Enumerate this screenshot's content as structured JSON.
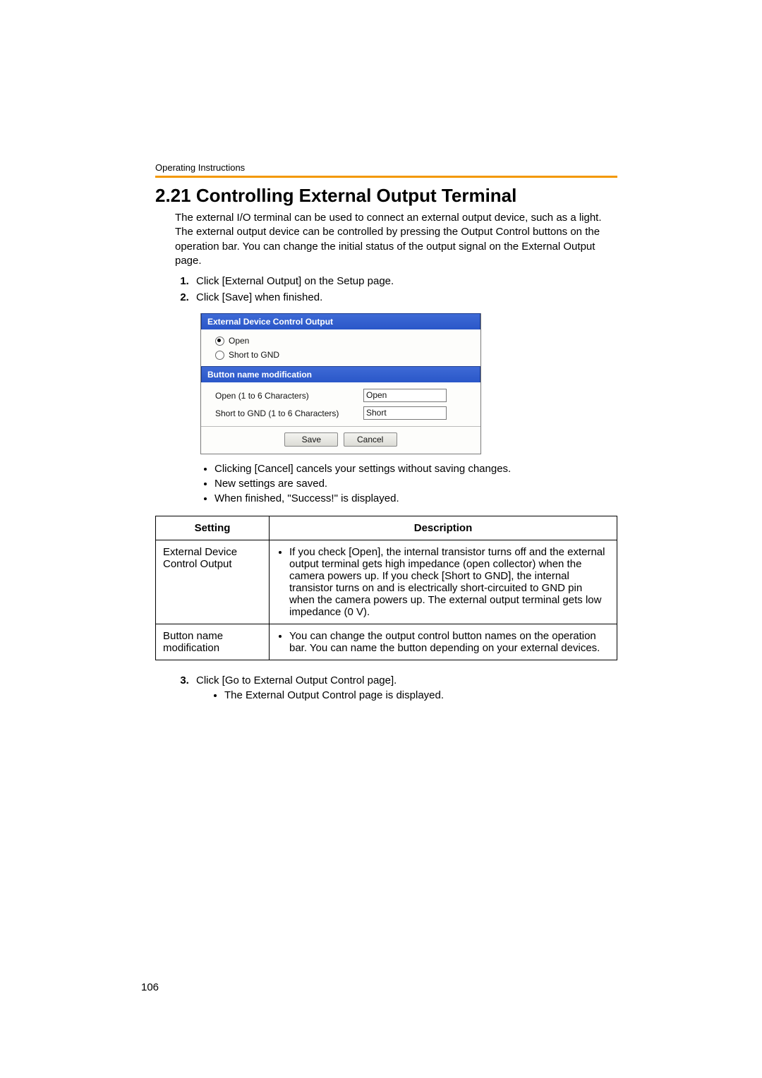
{
  "header": {
    "running": "Operating Instructions",
    "title": "2.21  Controlling External Output Terminal"
  },
  "intro": "The external I/O terminal can be used to connect an external output device, such as a light. The external output device can be controlled by pressing the Output Control buttons on the operation bar. You can change the initial status of the output signal on the External Output page.",
  "steps12": [
    "Click [External Output] on the Setup page.",
    "Click [Save] when finished."
  ],
  "dialog": {
    "section1": "External Device Control Output",
    "opt_open": "Open",
    "opt_short": "Short to GND",
    "section2": "Button name modification",
    "row_open_label": "Open (1 to 6 Characters)",
    "row_open_value": "Open",
    "row_short_label": "Short to GND (1 to 6 Characters)",
    "row_short_value": "Short",
    "btn_save": "Save",
    "btn_cancel": "Cancel"
  },
  "notes": [
    "Clicking [Cancel] cancels your settings without saving changes.",
    "New settings are saved.",
    "When finished, \"Success!\" is displayed."
  ],
  "table": {
    "head_setting": "Setting",
    "head_desc": "Description",
    "rows": [
      {
        "setting": "External Device Control Output",
        "desc": "If you check [Open], the internal transistor turns off and the external output terminal gets high impedance (open collector) when the camera powers up. If you check [Short to GND], the internal transistor turns on and is electrically short-circuited to GND pin when the camera powers up. The external output terminal gets low impedance (0 V)."
      },
      {
        "setting": "Button name modification",
        "desc": "You can change the output control button names on the operation bar. You can name the button depending on your external devices."
      }
    ]
  },
  "step3": {
    "text": "Click [Go to External Output Control page].",
    "sub": "The External Output Control page is displayed."
  },
  "page_number": "106"
}
